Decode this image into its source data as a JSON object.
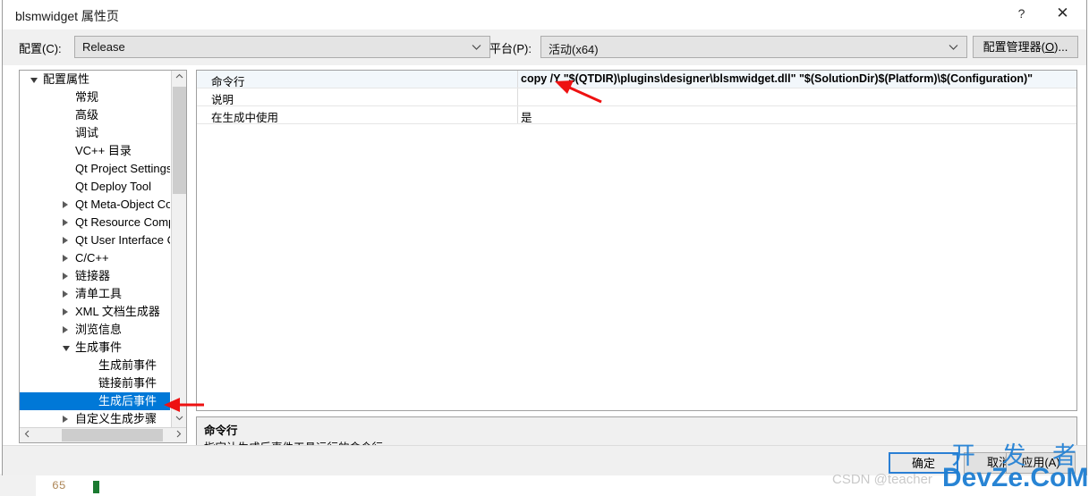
{
  "window": {
    "title": "blsmwidget 属性页",
    "help_label": "?",
    "close_label": "✕"
  },
  "toolbar": {
    "config_label": "配置(C):",
    "config_value": "Release",
    "platform_label": "平台(P):",
    "platform_value": "活动(x64)",
    "config_manager_label_pre": "配置管理器(",
    "config_manager_accel": "O",
    "config_manager_label_post": ")...",
    "config_manager_full": "配置管理器(O)..."
  },
  "tree": {
    "items": [
      {
        "label": "配置属性",
        "indent": 4,
        "state": "expanded",
        "selected": false
      },
      {
        "label": "常规",
        "indent": 40,
        "state": "leaf",
        "selected": false
      },
      {
        "label": "高级",
        "indent": 40,
        "state": "leaf",
        "selected": false
      },
      {
        "label": "调试",
        "indent": 40,
        "state": "leaf",
        "selected": false
      },
      {
        "label": "VC++ 目录",
        "indent": 40,
        "state": "leaf",
        "selected": false
      },
      {
        "label": "Qt Project Settings",
        "indent": 40,
        "state": "leaf",
        "selected": false
      },
      {
        "label": "Qt Deploy Tool",
        "indent": 40,
        "state": "leaf",
        "selected": false
      },
      {
        "label": "Qt Meta-Object Compiler",
        "indent": 40,
        "state": "collapsed",
        "selected": false
      },
      {
        "label": "Qt Resource Compiler",
        "indent": 40,
        "state": "collapsed",
        "selected": false
      },
      {
        "label": "Qt User Interface Compiler",
        "indent": 40,
        "state": "collapsed",
        "selected": false
      },
      {
        "label": "C/C++",
        "indent": 40,
        "state": "collapsed",
        "selected": false
      },
      {
        "label": "链接器",
        "indent": 40,
        "state": "collapsed",
        "selected": false
      },
      {
        "label": "清单工具",
        "indent": 40,
        "state": "collapsed",
        "selected": false
      },
      {
        "label": "XML 文档生成器",
        "indent": 40,
        "state": "collapsed",
        "selected": false
      },
      {
        "label": "浏览信息",
        "indent": 40,
        "state": "collapsed",
        "selected": false
      },
      {
        "label": "生成事件",
        "indent": 40,
        "state": "expanded",
        "selected": false
      },
      {
        "label": "生成前事件",
        "indent": 66,
        "state": "leaf",
        "selected": false
      },
      {
        "label": "链接前事件",
        "indent": 66,
        "state": "leaf",
        "selected": false
      },
      {
        "label": "生成后事件",
        "indent": 66,
        "state": "leaf",
        "selected": true
      },
      {
        "label": "自定义生成步骤",
        "indent": 40,
        "state": "collapsed",
        "selected": false
      }
    ],
    "scroll_up_icon": "chevron-up",
    "scroll_down_icon": "chevron-down",
    "scroll_left_icon": "chevron-left",
    "scroll_right_icon": "chevron-right"
  },
  "properties": {
    "rows": [
      {
        "name": "命令行",
        "value": "copy /Y \"$(QTDIR)\\plugins\\designer\\blsmwidget.dll\" \"$(SolutionDir)$(Platform)\\$(Configuration)\"",
        "bold": true,
        "highlight": true
      },
      {
        "name": "说明",
        "value": "",
        "bold": false,
        "highlight": false
      },
      {
        "name": "在生成中使用",
        "value": "是",
        "bold": false,
        "highlight": false
      }
    ]
  },
  "description": {
    "title": "命令行",
    "body": "指定让生成后事件工具运行的命令行。"
  },
  "buttons": {
    "ok": "确定",
    "cancel": "取消",
    "apply": "应用(A)"
  },
  "watermark": {
    "csdn": "CSDN @teacher",
    "cn": "开 发 者",
    "en": "DevZe.CoM"
  },
  "backdrop": {
    "line_number": "65"
  },
  "colors": {
    "selection_blue": "#0078d7",
    "annotation_red": "#ee1111",
    "default_button_border": "#2a7fd4",
    "dialog_bg": "#f0f0f0"
  }
}
